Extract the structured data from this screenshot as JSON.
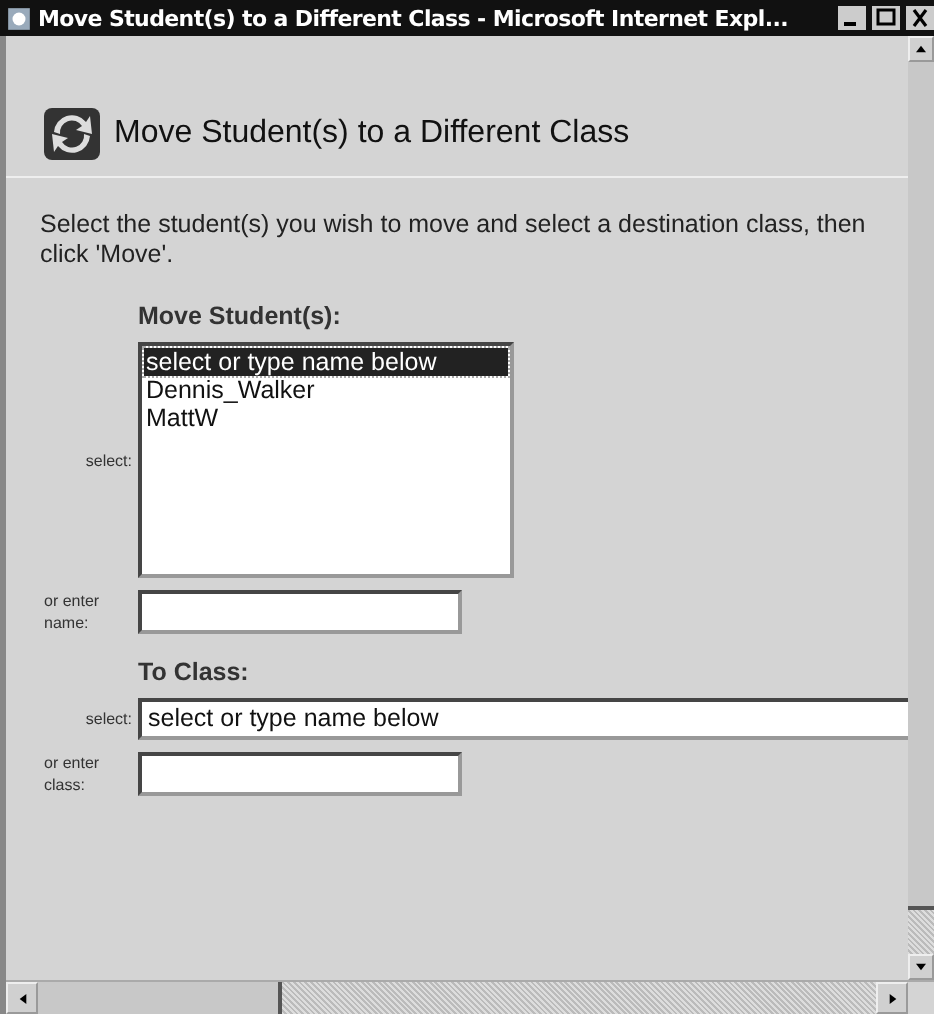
{
  "window": {
    "title": "Move Student(s) to a Different Class - Microsoft Internet Expl..."
  },
  "page": {
    "heading": "Move Student(s) to a Different Class",
    "instructions": "Select the student(s) you wish to move and select a destination class, then click 'Move'."
  },
  "students": {
    "heading": "Move Student(s):",
    "select_label": "select:",
    "options": [
      {
        "label": "select or type name below",
        "selected": true
      },
      {
        "label": "Dennis_Walker",
        "selected": false
      },
      {
        "label": "MattW",
        "selected": false
      }
    ],
    "enter_label": "or enter name:"
  },
  "class": {
    "heading": "To Class:",
    "select_label": "select:",
    "select_value": "select or type name below",
    "enter_label": "or enter class:"
  }
}
